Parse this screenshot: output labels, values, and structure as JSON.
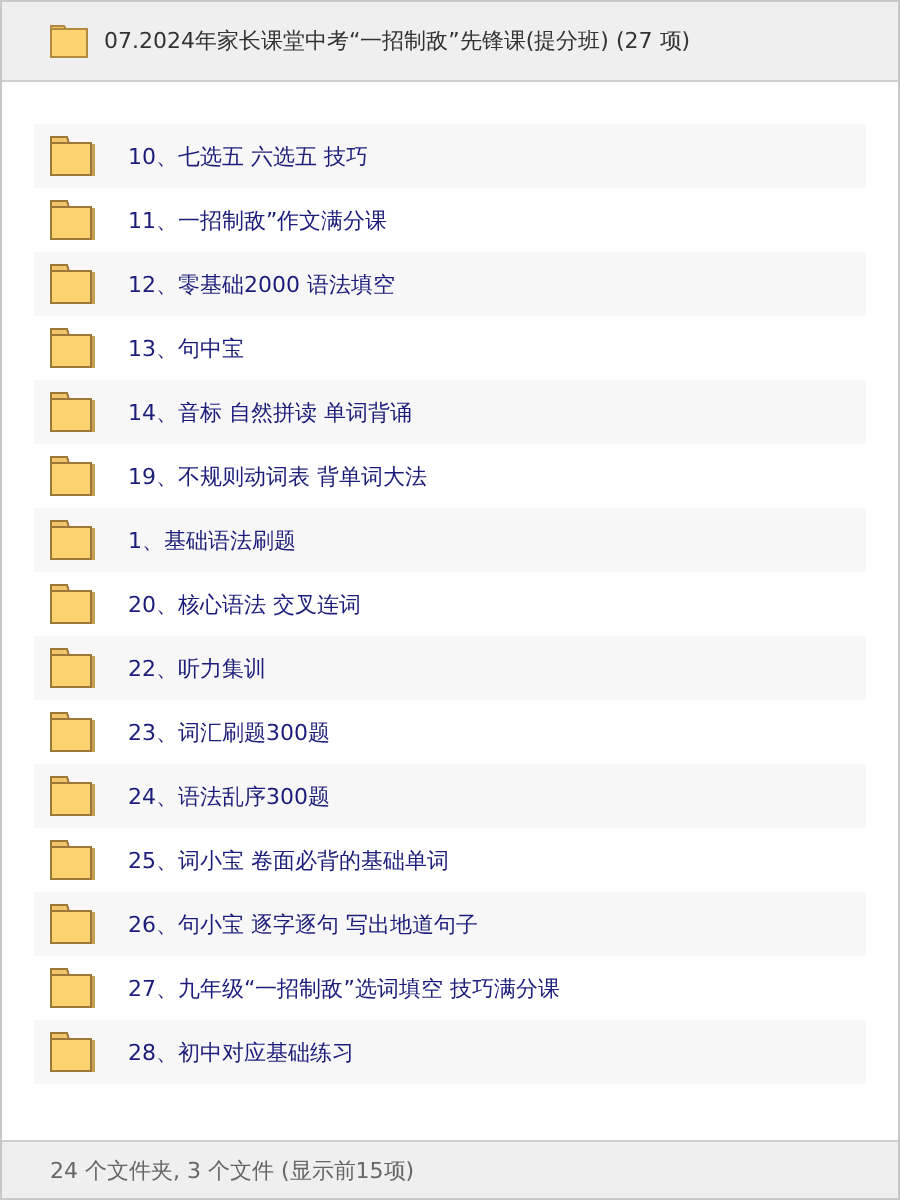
{
  "header": {
    "title": "07.2024年家长课堂中考“一招制敌”先锋课(提分班) (27 项)"
  },
  "items": [
    {
      "name": "10、七选五 六选五 技巧"
    },
    {
      "name": "11、一招制敌”作文满分课"
    },
    {
      "name": "12、零基础2000 语法填空"
    },
    {
      "name": "13、句中宝"
    },
    {
      "name": "14、音标 自然拼读 单词背诵"
    },
    {
      "name": "19、不规则动词表 背单词大法"
    },
    {
      "name": "1、基础语法刷题"
    },
    {
      "name": "20、核心语法 交叉连词"
    },
    {
      "name": "22、听力集训"
    },
    {
      "name": "23、词汇刷题300题"
    },
    {
      "name": "24、语法乱序300题"
    },
    {
      "name": "25、词小宝 卷面必背的基础单词"
    },
    {
      "name": "26、句小宝 逐字逐句 写出地道句子"
    },
    {
      "name": "27、九年级“一招制敌”选词填空 技巧满分课"
    },
    {
      "name": "28、初中对应基础练习"
    }
  ],
  "status_bar": {
    "text": "24 个文件夹, 3 个文件 (显示前15项)"
  }
}
